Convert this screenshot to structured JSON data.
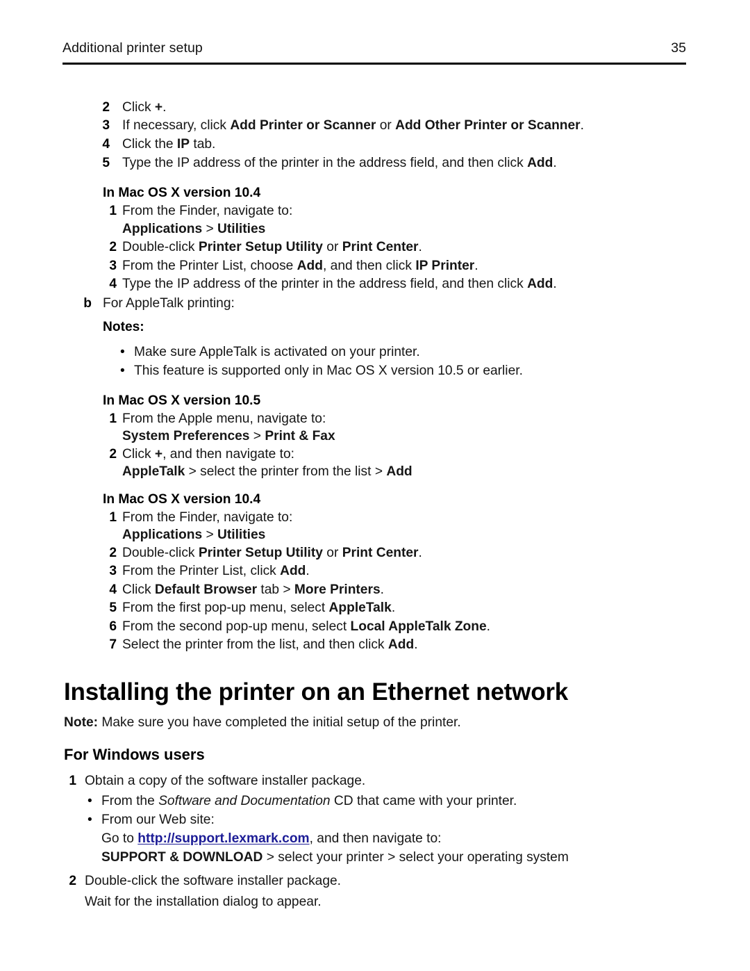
{
  "header": {
    "section_title": "Additional printer setup",
    "page_number": "35"
  },
  "link_color": "#1c1c96",
  "blocks": {
    "step2_num": "2",
    "step2_a": "Click ",
    "step2_b": "+",
    "step2_c": ".",
    "step3_num": "3",
    "step3_a": "If necessary, click ",
    "step3_b": "Add Printer or Scanner",
    "step3_c": " or ",
    "step3_d": "Add Other Printer or Scanner",
    "step3_e": ".",
    "step4_num": "4",
    "step4_a": "Click the ",
    "step4_b": "IP",
    "step4_c": " tab.",
    "step5_num": "5",
    "step5_a": "Type the IP address of the printer in the address field, and then click ",
    "step5_b": "Add",
    "step5_c": ".",
    "mac104_head_1": "In Mac OS X version 10.4",
    "m1_num": "1",
    "m1_text": "From the Finder, navigate to:",
    "m1_path_a": "Applications",
    "m1_path_sep": " > ",
    "m1_path_b": "Utilities",
    "m2_num": "2",
    "m2_a": "Double-click ",
    "m2_b": "Printer Setup Utility",
    "m2_c": " or ",
    "m2_d": "Print Center",
    "m2_e": ".",
    "m3_num": "3",
    "m3_a": "From the Printer List, choose ",
    "m3_b": "Add",
    "m3_c": ", and then click ",
    "m3_d": "IP Printer",
    "m3_e": ".",
    "m4_num": "4",
    "m4_a": "Type the IP address of the printer in the address field, and then click ",
    "m4_b": "Add",
    "m4_c": ".",
    "b_marker": "b",
    "b_text": "For AppleTalk printing:",
    "notes_label": "Notes:",
    "note_bullet_1": "Make sure AppleTalk is activated on your printer.",
    "note_bullet_2": "This feature is supported only in Mac OS X version 10.5 or earlier.",
    "mac105_head": "In Mac OS X version 10.5",
    "n1_num": "1",
    "n1_text": "From the Apple menu, navigate to:",
    "n1_path_a": "System Preferences",
    "n1_path_sep": " > ",
    "n1_path_b": "Print & Fax",
    "n2_num": "2",
    "n2_a": "Click ",
    "n2_b": "+",
    "n2_c": ", and then navigate to:",
    "n2_path_a": "AppleTalk",
    "n2_path_mid": " > select the printer from the list > ",
    "n2_path_b": "Add",
    "mac104_head_2": "In Mac OS X version 10.4",
    "p1_num": "1",
    "p1_text": "From the Finder, navigate to:",
    "p1_path_a": "Applications",
    "p1_path_sep": " > ",
    "p1_path_b": "Utilities",
    "p2_num": "2",
    "p2_a": "Double-click ",
    "p2_b": "Printer Setup Utility",
    "p2_c": " or ",
    "p2_d": "Print Center",
    "p2_e": ".",
    "p3_num": "3",
    "p3_a": "From the Printer List, click ",
    "p3_b": "Add",
    "p3_c": ".",
    "p4_num": "4",
    "p4_a": "Click ",
    "p4_b": "Default Browser",
    "p4_c": " tab > ",
    "p4_d": "More Printers",
    "p4_e": ".",
    "p5_num": "5",
    "p5_a": "From the first pop-up menu, select ",
    "p5_b": "AppleTalk",
    "p5_c": ".",
    "p6_num": "6",
    "p6_a": "From the second pop-up menu, select ",
    "p6_b": "Local AppleTalk Zone",
    "p6_c": ".",
    "p7_num": "7",
    "p7_a": "Select the printer from the list, and then click ",
    "p7_b": "Add",
    "p7_c": ".",
    "main_heading": "Installing the printer on an Ethernet network",
    "note_label": "Note:",
    "note_text": " Make sure you have completed the initial setup of the printer.",
    "windows_heading": "For Windows users",
    "w1_num": "1",
    "w1_text": "Obtain a copy of the software installer package.",
    "w_bullet1_a": "From the ",
    "w_bullet1_b": "Software and Documentation",
    "w_bullet1_c": " CD that came with your printer.",
    "w_bullet2": "From our Web site:",
    "goto_a": "Go to ",
    "goto_link": "http://support.lexmark.com",
    "goto_c": ", and then navigate to:",
    "support_a": "SUPPORT & DOWNLOAD",
    "support_b": " > select your printer > select your operating system",
    "w2_num": "2",
    "w2_text": "Double-click the software installer package.",
    "w2_sub": "Wait for the installation dialog to appear."
  }
}
